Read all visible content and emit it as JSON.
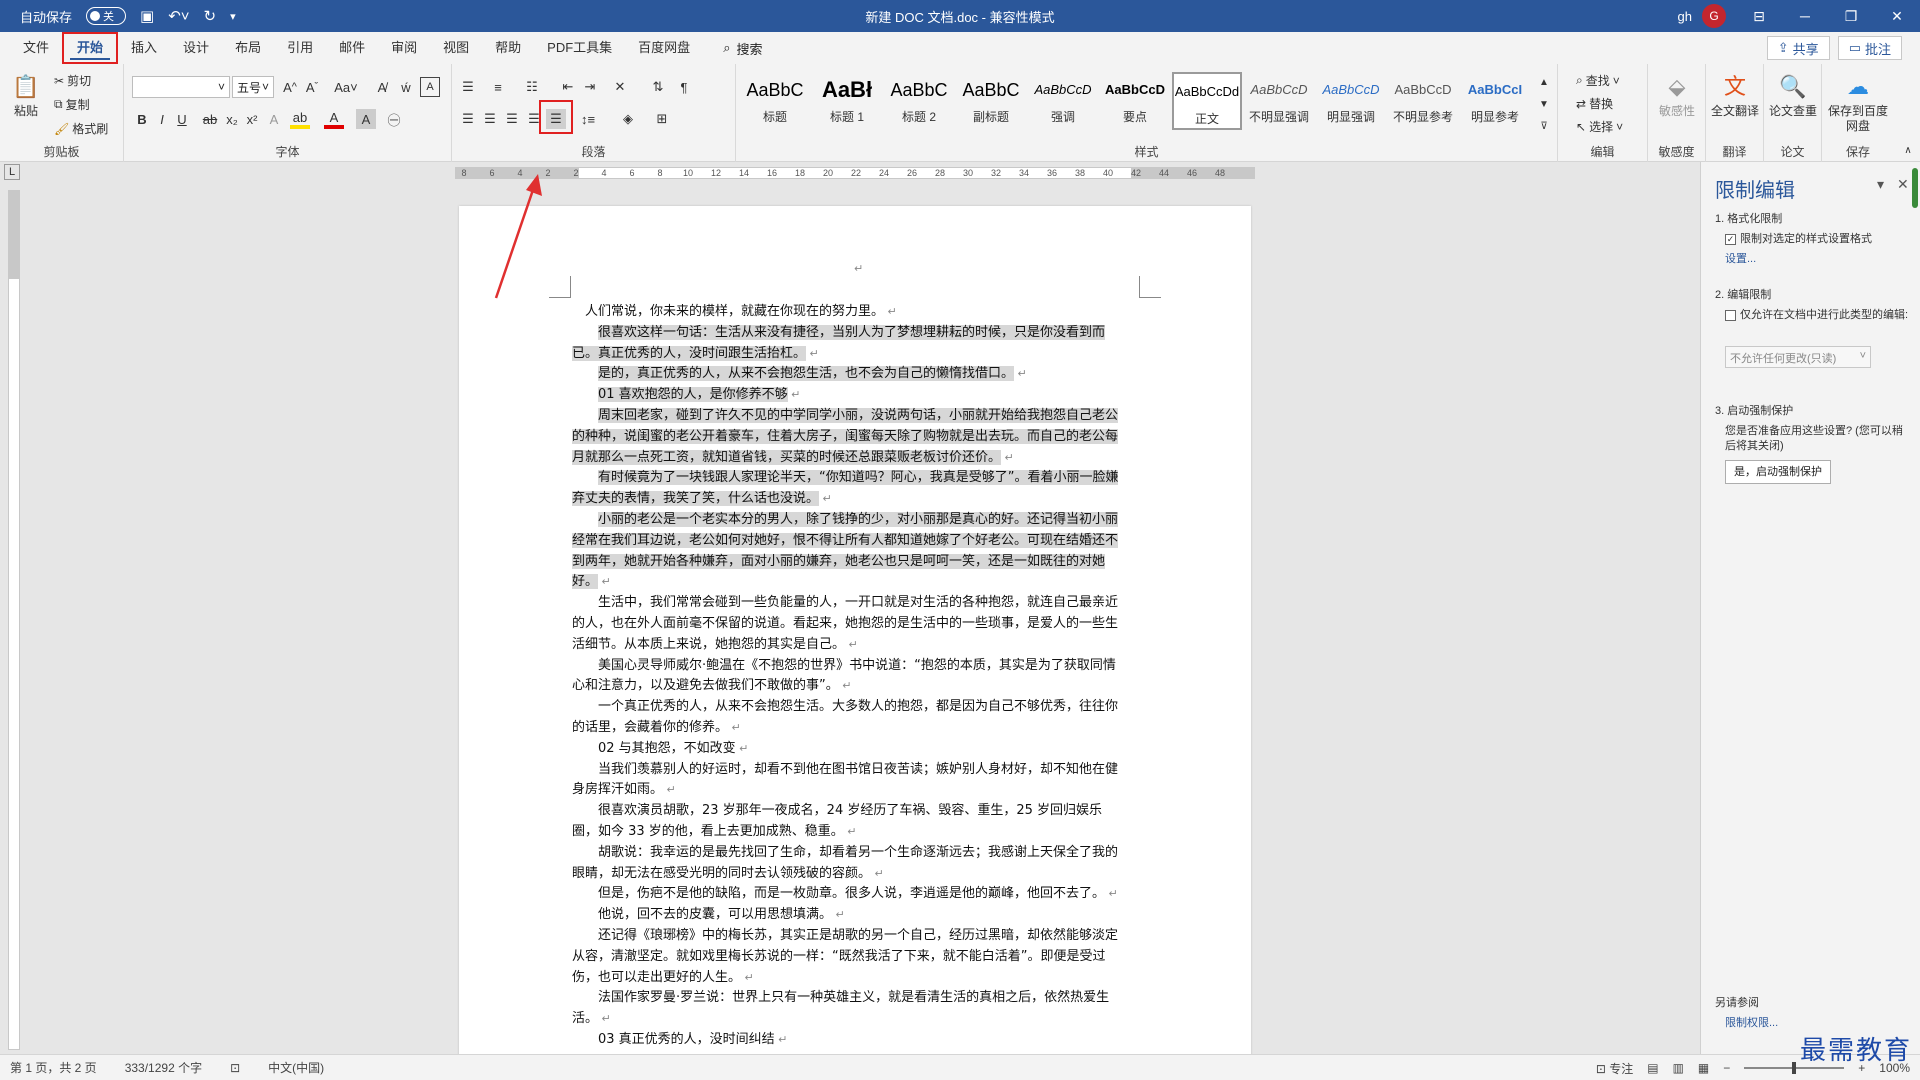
{
  "titlebar": {
    "autosave_label": "自动保存",
    "autosave_state": "关",
    "doc_title": "新建 DOC 文档.doc  -  兼容性模式",
    "user": "gh",
    "avatar_letter": "G"
  },
  "tabs": [
    "文件",
    "开始",
    "插入",
    "设计",
    "布局",
    "引用",
    "邮件",
    "审阅",
    "视图",
    "帮助",
    "PDF工具集",
    "百度网盘"
  ],
  "search_label": "搜索",
  "share_label": "共享",
  "comment_label": "批注",
  "clipboard": {
    "paste": "粘贴",
    "cut": "剪切",
    "copy": "复制",
    "format_painter": "格式刷",
    "label": "剪贴板"
  },
  "font": {
    "name": "",
    "size": "五号",
    "label": "字体"
  },
  "paragraph": {
    "label": "段落"
  },
  "styles": {
    "label": "样式",
    "items": [
      {
        "sample": "AaBbC",
        "name": "标题"
      },
      {
        "sample": "AaBł",
        "name": "标题 1"
      },
      {
        "sample": "AaBbC",
        "name": "标题 2"
      },
      {
        "sample": "AaBbC",
        "name": "副标题"
      },
      {
        "sample": "AaBbCcD",
        "name": "强调"
      },
      {
        "sample": "AaBbCcD",
        "name": "要点"
      },
      {
        "sample": "AaBbCcDd",
        "name": "正文"
      },
      {
        "sample": "AaBbCcD",
        "name": "不明显强调"
      },
      {
        "sample": "AaBbCcD",
        "name": "明显强调"
      },
      {
        "sample": "AaBbCcD",
        "name": "不明显参考"
      },
      {
        "sample": "AaBbCcI",
        "name": "明显参考"
      }
    ]
  },
  "editing": {
    "find": "查找",
    "replace": "替换",
    "select": "选择",
    "label": "编辑"
  },
  "sensitivity": {
    "btn": "敏感性",
    "label": "敏感度"
  },
  "translate": {
    "btn": "全文翻译",
    "label": "翻译"
  },
  "paper": {
    "btn": "论文查重",
    "label": "论文"
  },
  "save": {
    "btn": "保存到百度网盘",
    "label": "保存"
  },
  "ruler_numbers": [
    "8",
    "6",
    "4",
    "2",
    "2",
    "4",
    "6",
    "8",
    "10",
    "12",
    "14",
    "16",
    "18",
    "20",
    "22",
    "24",
    "26",
    "28",
    "30",
    "32",
    "34",
    "36",
    "38",
    "40",
    "42",
    "44",
    "46",
    "48"
  ],
  "document": {
    "paragraphs": [
      {
        "text": "人们常说，你未来的模样，就藏在你现在的努力里。",
        "hl": false
      },
      {
        "text": "很喜欢这样一句话：生活从来没有捷径，当别人为了梦想埋耕耘的时候，只是你没看到而已。真正优秀的人，没时间跟生活抬杠。",
        "hl": true
      },
      {
        "text": "是的，真正优秀的人，从来不会抱怨生活，也不会为自己的懒惰找借口。",
        "hl": true
      },
      {
        "text": "01 喜欢抱怨的人，是你修养不够",
        "hl": true
      },
      {
        "text": "周末回老家，碰到了许久不见的中学同学小丽，没说两句话，小丽就开始给我抱怨自己老公的种种，说闺蜜的老公开着豪车，住着大房子，闺蜜每天除了购物就是出去玩。而自己的老公每月就那么一点死工资，就知道省钱，买菜的时候还总跟菜贩老板讨价还价。",
        "hl": true
      },
      {
        "text": "有时候竟为了一块钱跟人家理论半天，“你知道吗？阿心，我真是受够了”。看着小丽一脸嫌弃丈夫的表情，我笑了笑，什么话也没说。",
        "hl": true
      },
      {
        "text": "小丽的老公是一个老实本分的男人，除了钱挣的少，对小丽那是真心的好。还记得当初小丽经常在我们耳边说，老公如何对她好，恨不得让所有人都知道她嫁了个好老公。可现在结婚还不到两年，她就开始各种嫌弃，面对小丽的嫌弃，她老公也只是呵呵一笑，还是一如既往的对她好。",
        "hl": "part"
      },
      {
        "text": "生活中，我们常常会碰到一些负能量的人，一开口就是对生活的各种抱怨，就连自己最亲近的人，也在外人面前毫不保留的说道。看起来，她抱怨的是生活中的一些琐事，是爱人的一些生活细节。从本质上来说，她抱怨的其实是自己。",
        "hl": false
      },
      {
        "text": "美国心灵导师威尔·鲍温在《不抱怨的世界》书中说道：“抱怨的本质，其实是为了获取同情心和注意力，以及避免去做我们不敢做的事”。",
        "hl": false
      },
      {
        "text": "一个真正优秀的人，从来不会抱怨生活。大多数人的抱怨，都是因为自己不够优秀，往往你的话里，会藏着你的修养。",
        "hl": false
      },
      {
        "text": "02 与其抱怨，不如改变",
        "hl": false
      },
      {
        "text": "当我们羡慕别人的好运时，却看不到他在图书馆日夜苦读；嫉妒别人身材好，却不知他在健身房挥汗如雨。",
        "hl": false
      },
      {
        "text": "很喜欢演员胡歌，23 岁那年一夜成名，24 岁经历了车祸、毁容、重生，25 岁回归娱乐圈，如今 33 岁的他，看上去更加成熟、稳重。",
        "hl": false
      },
      {
        "text": "胡歌说：我幸运的是最先找回了生命，却看着另一个生命逐渐远去；我感谢上天保全了我的眼睛，却无法在感受光明的同时去认领残破的容颜。",
        "hl": false
      },
      {
        "text": "但是，伤疤不是他的缺陷，而是一枚勋章。很多人说，李逍遥是他的巅峰，他回不去了。",
        "hl": false
      },
      {
        "text": "他说，回不去的皮囊，可以用思想填满。",
        "hl": false
      },
      {
        "text": "还记得《琅琊榜》中的梅长苏，其实正是胡歌的另一个自己，经历过黑暗，却依然能够淡定从容，清澈坚定。就如戏里梅长苏说的一样：“既然我活了下来，就不能白活着”。即便是受过伤，也可以走出更好的人生。",
        "hl": false
      },
      {
        "text": "法国作家罗曼·罗兰说：世界上只有一种英雄主义，就是看清生活的真相之后，依然热爱生活。",
        "hl": false
      },
      {
        "text": "03 真正优秀的人，没时间纠结",
        "hl": false
      }
    ]
  },
  "pane": {
    "title": "限制编辑",
    "s1": "1. 格式化限制",
    "s1_check": "限制对选定的样式设置格式",
    "s1_link": "设置...",
    "s2": "2. 编辑限制",
    "s2_check": "仅允许在文档中进行此类型的编辑:",
    "s2_select": "不允许任何更改(只读)",
    "s3": "3. 启动强制保护",
    "s3_text": "您是否准备应用这些设置? (您可以稍后将其关闭)",
    "s3_button": "是，启动强制保护",
    "see_also": "另请参阅",
    "see_link": "限制权限..."
  },
  "status": {
    "page": "第 1 页，共 2 页",
    "words": "333/1292 个字",
    "lang": "中文(中国)",
    "focus": "专注",
    "zoom": "100%"
  },
  "watermark": "最需教育"
}
